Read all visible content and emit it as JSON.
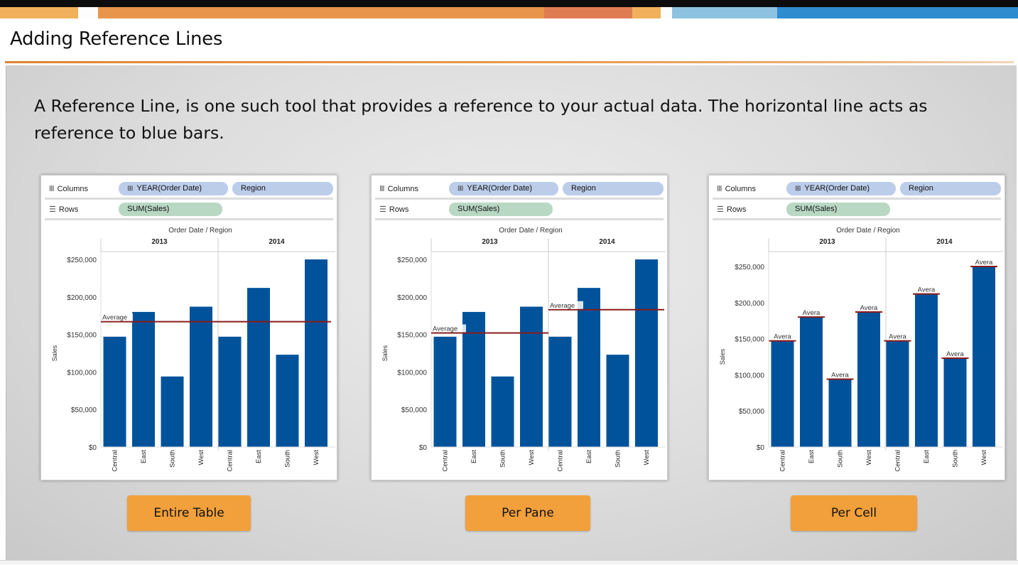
{
  "slide": {
    "title": "Adding Reference Lines",
    "description": "A Reference Line, is one such tool that provides a reference to your actual data. The horizontal line acts as reference to blue bars."
  },
  "colors": {
    "bar": "#00539b",
    "reference_line": "#8b1b1b",
    "button": "#f2a03b",
    "shelf_blue": "#bccdea",
    "shelf_green": "#b9d8c4"
  },
  "shelf": {
    "columns_label": "Columns",
    "rows_label": "Rows",
    "columns_icon": "columns-icon",
    "rows_icon": "rows-icon",
    "pill_year": "YEAR(Order Date)",
    "pill_region": "Region",
    "pill_sales": "SUM(Sales)",
    "expand_icon": "plus-box-icon"
  },
  "buttons": [
    "Entire Table",
    "Per Pane",
    "Per Cell"
  ],
  "chart_data": [
    {
      "type": "bar",
      "title": "Order Date  /  Region",
      "ylabel": "Sales",
      "headers": [
        "2013",
        "2014"
      ],
      "categories": [
        "Central",
        "East",
        "South",
        "West",
        "Central",
        "East",
        "South",
        "West"
      ],
      "values": [
        147000,
        180000,
        94000,
        187000,
        147000,
        212000,
        123000,
        250000
      ],
      "ylim": [
        0,
        250000
      ],
      "yticks": [
        "$0",
        "$50,000",
        "$100,000",
        "$150,000",
        "$200,000",
        "$250,000"
      ],
      "reference_scope": "table",
      "reference_label": "Average",
      "reference_values": [
        167000
      ]
    },
    {
      "type": "bar",
      "title": "Order Date  /  Region",
      "ylabel": "Sales",
      "headers": [
        "2013",
        "2014"
      ],
      "categories": [
        "Central",
        "East",
        "South",
        "West",
        "Central",
        "East",
        "South",
        "West"
      ],
      "values": [
        147000,
        180000,
        94000,
        187000,
        147000,
        212000,
        123000,
        250000
      ],
      "ylim": [
        0,
        250000
      ],
      "yticks": [
        "$0",
        "$50,000",
        "$100,000",
        "$150,000",
        "$200,000",
        "$250,000"
      ],
      "reference_scope": "pane",
      "reference_label": "Average",
      "reference_values": [
        152000,
        183000
      ]
    },
    {
      "type": "bar",
      "title": "Order Date  /  Region",
      "ylabel": "Sales",
      "headers": [
        "2013",
        "2014"
      ],
      "categories": [
        "Central",
        "East",
        "South",
        "West",
        "Central",
        "East",
        "South",
        "West"
      ],
      "values": [
        147000,
        180000,
        94000,
        187000,
        147000,
        212000,
        123000,
        250000
      ],
      "ylim": [
        0,
        250000
      ],
      "yticks": [
        "$0",
        "$50,000",
        "$100,000",
        "$150,000",
        "$200,000",
        "$250,000"
      ],
      "reference_scope": "cell",
      "reference_label": "Avera",
      "reference_values": [
        147000,
        180000,
        94000,
        187000,
        147000,
        212000,
        123000,
        250000
      ]
    }
  ]
}
